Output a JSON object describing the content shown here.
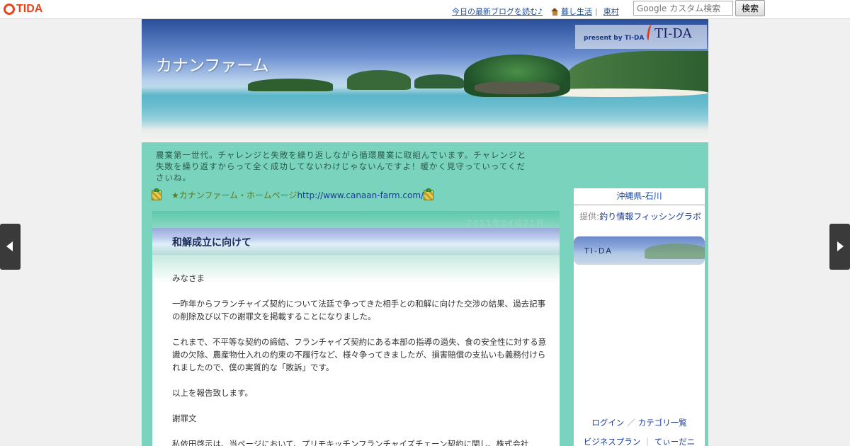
{
  "topbar": {
    "logo": "TIDA",
    "links": [
      "今日の最新ブログを読む♪",
      "暮し生活",
      "東村"
    ],
    "search_placeholder": "Google カスタム検索",
    "search_button": "検索"
  },
  "blog": {
    "title": "カナンファーム",
    "present": "present by TI-DA",
    "tida_logo": "TI-DA",
    "description": "農業第一世代。チャレンジと失敗を繰り返しながら循環農業に取組んでいます。チャレンジと失敗を繰り返すからって全く成功してないわけじゃないんですよ！暖かく見守っていってくださいね。",
    "homepage_label": "★カナンファーム・ホームページ",
    "homepage_url": "http://www.canaan-farm.com/"
  },
  "entry": {
    "date": "2011年04月21日",
    "title": "和解成立に向けて",
    "paragraphs": [
      "みなさま",
      "一昨年からフランチャイズ契約について法廷で争ってきた相手との和解に向けた交渉の結果、過去記事の削除及び以下の謝罪文を掲載することになりました。",
      "これまで、不平等な契約の締結、フランチャイズ契約にある本部の指導の過失、食の安全性に対する意識の欠除、農産物仕入れの約束の不履行など、様々争ってきましたが、損害賠償の支払いも義務付けられましたので、僕の実質的な「敗訴」です。",
      "以上を報告致します。",
      "謝罪文",
      "私依田啓示は、当ページにおいて、プリモキッチンフランチャイズチェーン契約に関し、株式会社"
    ]
  },
  "sidebar": {
    "location": "沖縄県-石川",
    "provider_prefix": "提供:",
    "provider_link": "釣り情報フィッシングラボ",
    "tida_label": "TI-DA",
    "login": "ログイン",
    "category": "カテゴリ一覧",
    "business": "ビジネスプラン",
    "tidani": "てぃーだニ",
    "slash1": "／",
    "slash2": "｜"
  },
  "colors": {
    "page_bg": "#7ad4bd",
    "logo": "#e8431b",
    "link": "#1a4fa0"
  }
}
